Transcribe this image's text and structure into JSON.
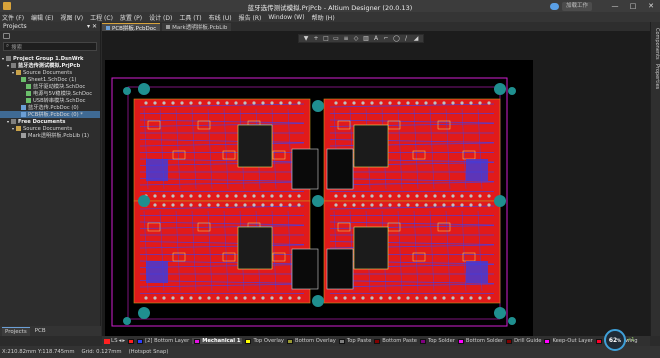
{
  "window": {
    "title": "蓝牙选传测试模拟.PrjPcb - Altium Designer (20.0.13)",
    "upgrade_label": "加载工作",
    "controls": [
      "—",
      "□",
      "✕"
    ]
  },
  "menu": [
    "文件 (F)",
    "编辑 (E)",
    "视图 (V)",
    "工程 (C)",
    "放置 (P)",
    "设计 (D)",
    "工具 (T)",
    "布线 (U)",
    "报告 (R)",
    "Window (W)",
    "帮助 (H)"
  ],
  "projects_panel": {
    "title": "Projects",
    "search_placeholder": "搜索",
    "tree": [
      {
        "label": "Project Group 1.DsnWrk",
        "icon": "proj",
        "indent": 0,
        "bold": true
      },
      {
        "label": "蓝牙选传测试模拟.PrjPcb",
        "icon": "proj",
        "indent": 1,
        "bold": true
      },
      {
        "label": "Source Documents",
        "icon": "folder",
        "indent": 2
      },
      {
        "label": "Sheet1.SchDoc (1)",
        "icon": "sch",
        "indent": 3
      },
      {
        "label": "蓝牙驱动模块.SchDoc",
        "icon": "sch",
        "indent": 4
      },
      {
        "label": "电源与5V稳模块.SchDoc",
        "icon": "sch",
        "indent": 4
      },
      {
        "label": "USB转串模块.SchDoc",
        "icon": "sch",
        "indent": 4
      },
      {
        "label": "蓝牙选传.PcbDoc (0)",
        "icon": "pcb",
        "indent": 3
      },
      {
        "label": "PCB拼板.PcbDoc (0) *",
        "icon": "pcb",
        "indent": 3,
        "selected": true
      },
      {
        "label": "Free Documents",
        "icon": "proj",
        "indent": 1,
        "bold": true
      },
      {
        "label": "Source Documents",
        "icon": "folder",
        "indent": 2
      },
      {
        "label": "Mark透明拼板.PcbLib (1)",
        "icon": "doc",
        "indent": 3
      }
    ],
    "bottom_tabs": [
      "Projects",
      "PCB"
    ]
  },
  "doc_tabs": [
    {
      "label": "PCB拼板.PcbDoc",
      "active": true
    },
    {
      "label": "Mark透明拼板.PcbLib",
      "active": false
    }
  ],
  "float_toolbar": [
    "▼",
    "+",
    "□",
    "▭",
    "≡",
    "◇",
    "▥",
    "A",
    "⌐",
    "◯",
    "/",
    "◢"
  ],
  "right_panel_tabs": [
    "Components",
    "Properties"
  ],
  "layers": {
    "ls_label": "LS",
    "items": [
      {
        "name": "[1] Top Layer",
        "color": "#ff2020",
        "visible_label": false
      },
      {
        "name": "[2] Bottom Layer",
        "color": "#2d3dff"
      },
      {
        "name": "Mechanical 1",
        "color": "#e010e0",
        "active": true
      },
      {
        "name": "Top Overlay",
        "color": "#ffff00"
      },
      {
        "name": "Bottom Overlay",
        "color": "#9a9a32"
      },
      {
        "name": "Top Paste",
        "color": "#808080"
      },
      {
        "name": "Bottom Paste",
        "color": "#800000"
      },
      {
        "name": "Top Solder",
        "color": "#800080"
      },
      {
        "name": "Bottom Solder",
        "color": "#ff00ff"
      },
      {
        "name": "Drill Guide",
        "color": "#800000"
      },
      {
        "name": "Keep-Out Layer",
        "color": "#ff00ff"
      },
      {
        "name": "Drill Drawing",
        "color": "#ff002a"
      }
    ]
  },
  "status": {
    "coords": "X:210.82mm Y:118.745mm",
    "grid": "Grid: 0.127mm",
    "snap": "(Hotspot Snap)"
  },
  "gauge": {
    "value": "62",
    "unit": "%",
    "tag": "+1"
  }
}
